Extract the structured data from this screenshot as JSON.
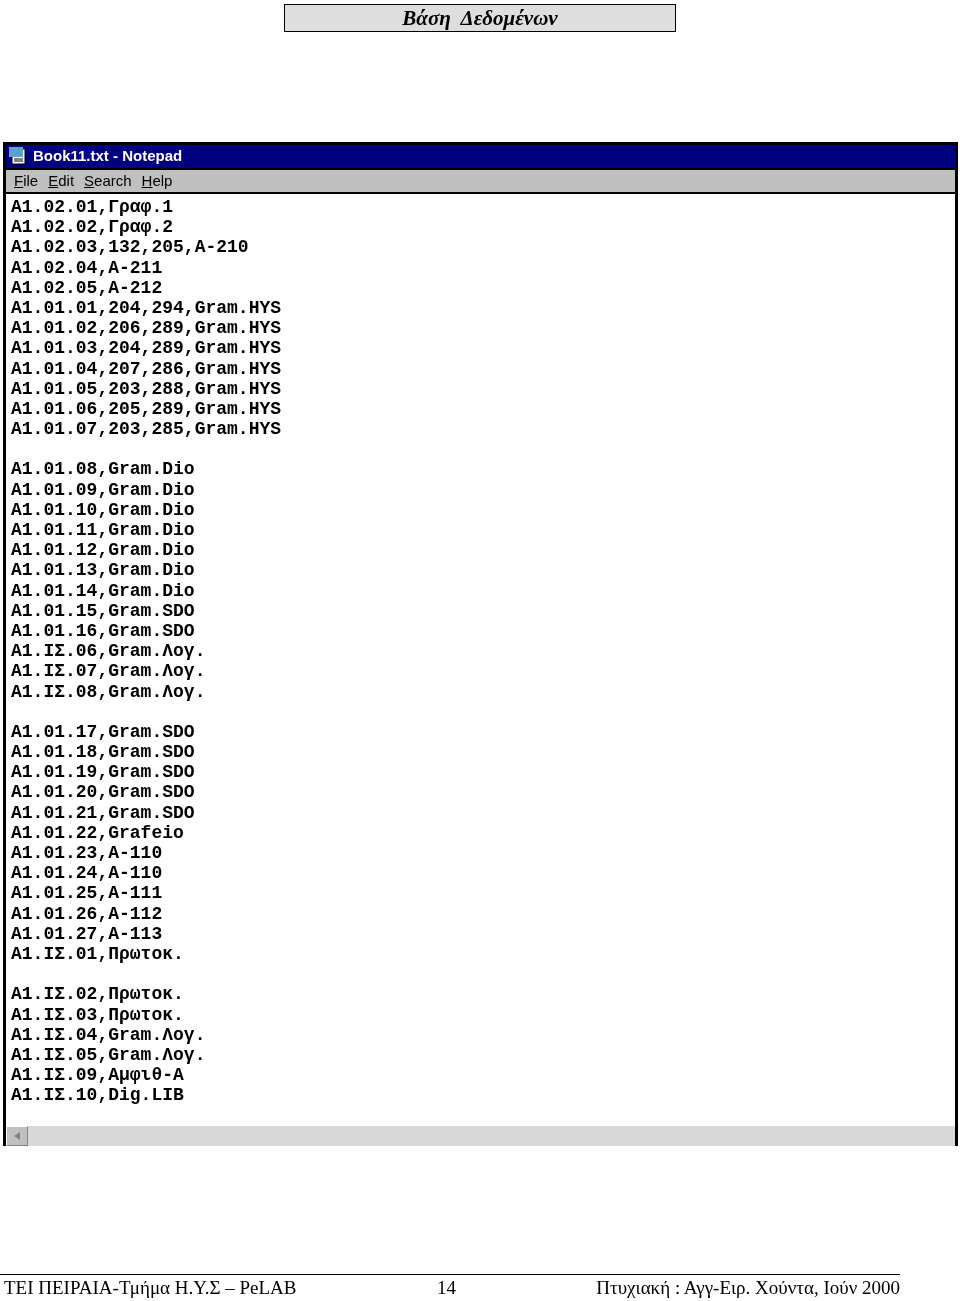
{
  "heading": "Βάση  Δεδομένων",
  "window": {
    "title": "Book11.txt - Notepad"
  },
  "menu": [
    {
      "label": "File",
      "underline_first": true
    },
    {
      "label": "Edit",
      "underline_first": true
    },
    {
      "label": "Search",
      "underline_first": true
    },
    {
      "label": "Help",
      "underline_first": true
    }
  ],
  "blocks": [
    [
      "A1.02.01,Γραφ.1",
      "A1.02.02,Γραφ.2",
      "A1.02.03,132,205,A-210",
      "A1.02.04,A-211",
      "A1.02.05,A-212",
      "A1.01.01,204,294,Gram.HYS",
      "A1.01.02,206,289,Gram.HYS",
      "A1.01.03,204,289,Gram.HYS",
      "A1.01.04,207,286,Gram.HYS",
      "A1.01.05,203,288,Gram.HYS",
      "A1.01.06,205,289,Gram.HYS",
      "A1.01.07,203,285,Gram.HYS"
    ],
    [
      "A1.01.08,Gram.Dio",
      "A1.01.09,Gram.Dio",
      "A1.01.10,Gram.Dio",
      "A1.01.11,Gram.Dio",
      "A1.01.12,Gram.Dio",
      "A1.01.13,Gram.Dio",
      "A1.01.14,Gram.Dio",
      "A1.01.15,Gram.SDO",
      "A1.01.16,Gram.SDO",
      "A1.IΣ.06,Gram.Λογ.",
      "A1.IΣ.07,Gram.Λογ.",
      "A1.IΣ.08,Gram.Λογ."
    ],
    [
      "A1.01.17,Gram.SDO",
      "A1.01.18,Gram.SDO",
      "A1.01.19,Gram.SDO",
      "A1.01.20,Gram.SDO",
      "A1.01.21,Gram.SDO",
      "A1.01.22,Grafeio",
      "A1.01.23,A-110",
      "A1.01.24,A-110",
      "A1.01.25,A-111",
      "A1.01.26,A-112",
      "A1.01.27,A-113",
      "A1.IΣ.01,Πρωτοκ."
    ],
    [
      "A1.IΣ.02,Πρωτοκ.",
      "A1.IΣ.03,Πρωτοκ.",
      "A1.IΣ.04,Gram.Λογ.",
      "A1.IΣ.05,Gram.Λογ.",
      "A1.IΣ.09,Αμφιθ-Α",
      "A1.IΣ.10,Dig.LIB"
    ]
  ],
  "footer": {
    "left": "ΤΕΙ ΠΕΙΡΑΙΑ-Τμήμα Η.Υ.Σ – PeLAB",
    "page": "14",
    "right": "Πτυχιακή : Αγγ-Ειρ. Χούντα, Ιούν 2000"
  }
}
